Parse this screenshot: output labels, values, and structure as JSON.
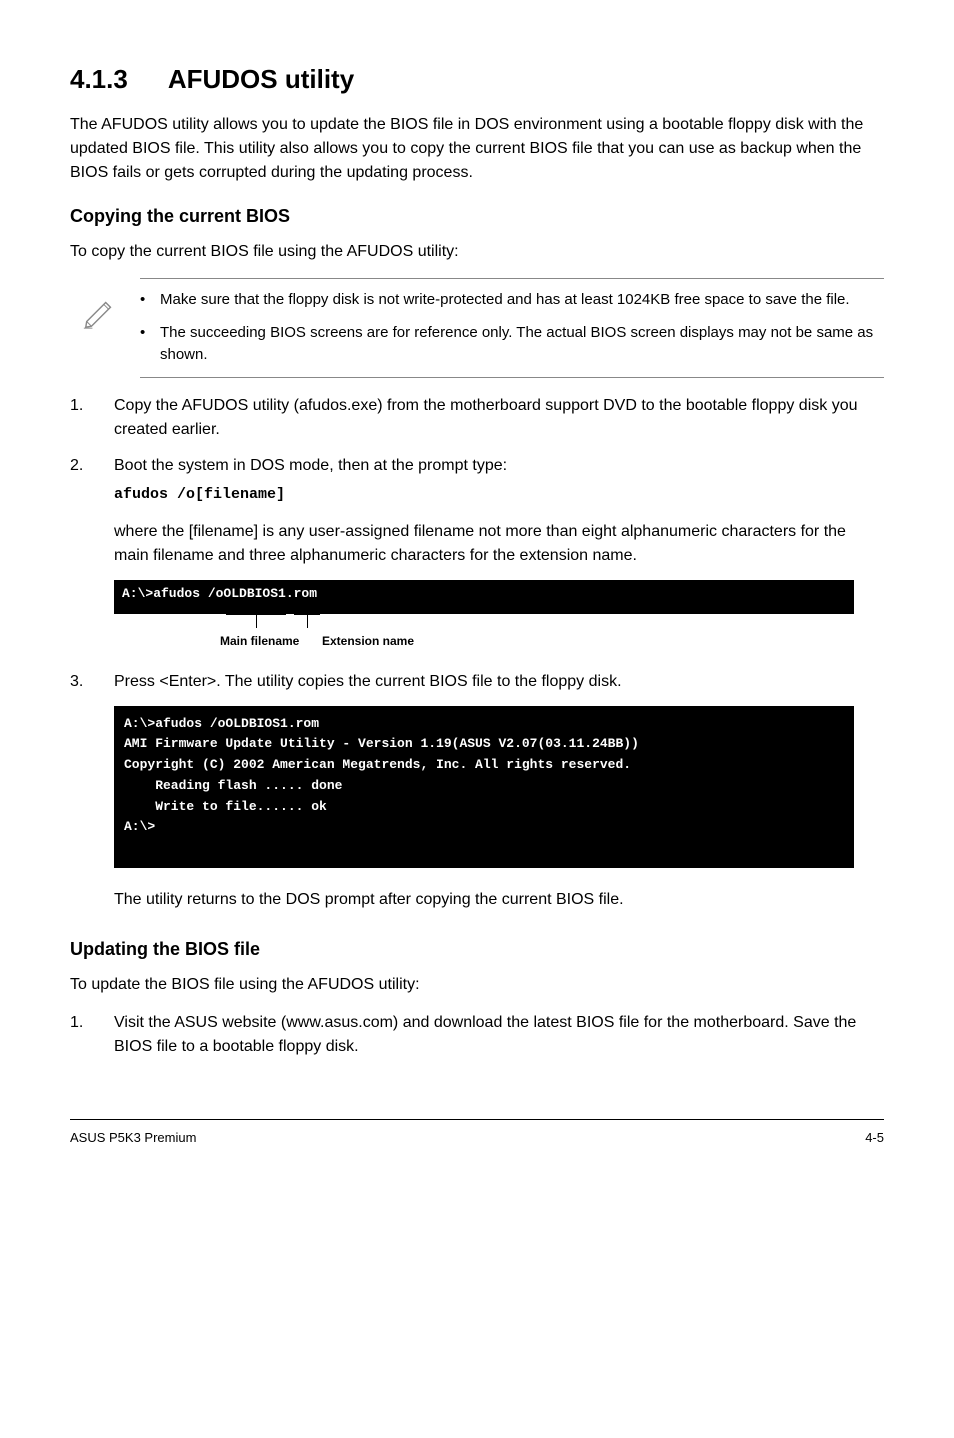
{
  "section": {
    "number": "4.1.3",
    "title": "AFUDOS utility"
  },
  "intro": "The AFUDOS utility allows you to update the BIOS file in DOS environment using a bootable floppy disk with the updated BIOS file. This utility also allows you to copy the current BIOS file that you can use as backup when the BIOS fails or gets corrupted during the updating process.",
  "copying": {
    "heading": "Copying the current BIOS",
    "subintro": "To copy the current BIOS file using the AFUDOS utility:",
    "notes": [
      "Make sure that the floppy disk is not write-protected and has at least 1024KB free space to save the file.",
      "The succeeding BIOS screens are for reference only. The actual BIOS screen displays may not be same as shown."
    ],
    "steps": [
      "Copy the AFUDOS utility (afudos.exe) from the motherboard support DVD to the bootable floppy disk you created earlier.",
      "Boot the system in DOS mode, then at the prompt type:"
    ],
    "command": "afudos /o[filename]",
    "where": "where the [filename] is any user-assigned filename not more than eight alphanumeric characters  for the main filename and three alphanumeric characters for the extension name."
  },
  "terminal_small": "A:\\>afudos /oOLDBIOS1.rom",
  "markers": {
    "main": "Main filename",
    "ext": "Extension name"
  },
  "step3": "Press <Enter>. The utility copies the current BIOS file to the floppy disk.",
  "terminal_large": "A:\\>afudos /oOLDBIOS1.rom\nAMI Firmware Update Utility - Version 1.19(ASUS V2.07(03.11.24BB))\nCopyright (C) 2002 American Megatrends, Inc. All rights reserved.\n    Reading flash ..... done\n    Write to file...... ok\nA:\\>",
  "after_terminal": "The utility returns to the DOS prompt after copying the current BIOS file.",
  "updating": {
    "heading": "Updating the BIOS file",
    "subintro": "To update the BIOS file using the AFUDOS utility:",
    "steps": [
      "Visit the ASUS website (www.asus.com) and download the latest BIOS file for the motherboard. Save the BIOS file to a bootable floppy disk."
    ]
  },
  "footer": {
    "left": "ASUS P5K3 Premium",
    "right": "4-5"
  }
}
